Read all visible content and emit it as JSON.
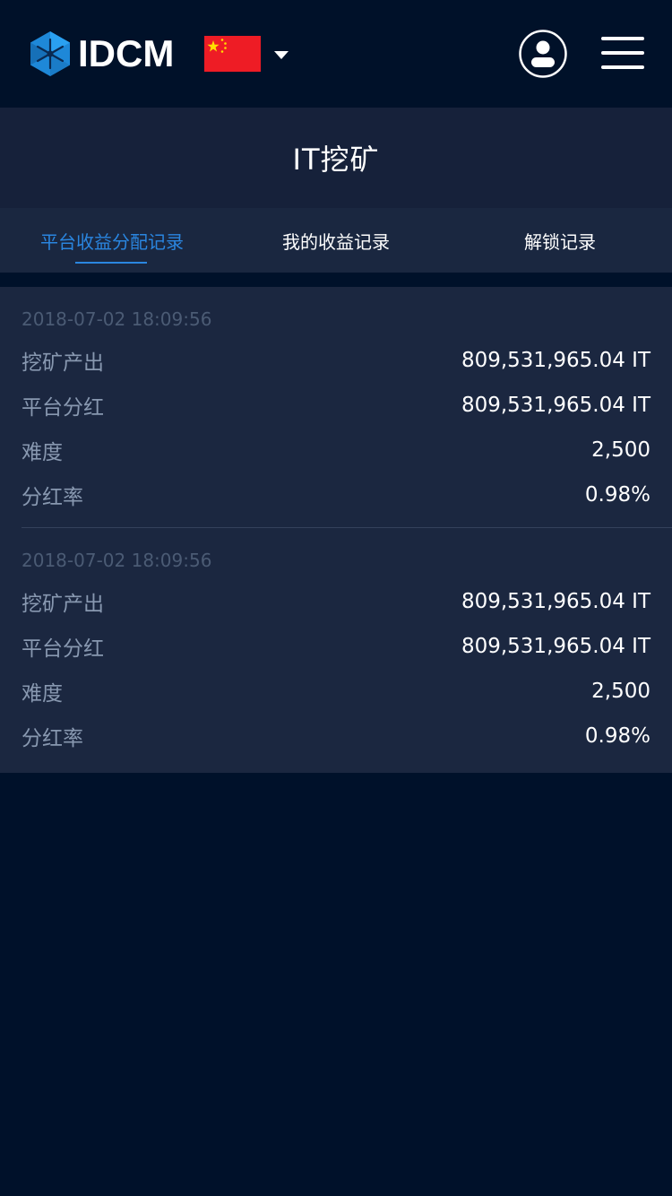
{
  "header": {
    "logo_text": "IDCM",
    "language_flag": "cn-flag",
    "colors": {
      "background": "#001129",
      "logo_blue": "#1e88d8",
      "flag_red": "#ee1c25",
      "flag_yellow": "#ffde00"
    }
  },
  "page": {
    "title": "IT挖矿"
  },
  "tabs": [
    {
      "label": "平台收益分配记录",
      "active": true
    },
    {
      "label": "我的收益记录",
      "active": false
    },
    {
      "label": "解锁记录",
      "active": false
    }
  ],
  "accent_color": "#2a86e0",
  "records": [
    {
      "time": "2018-07-02 18:09:56",
      "rows": [
        {
          "label": "挖矿产出",
          "value": "809,531,965.04 IT"
        },
        {
          "label": "平台分红",
          "value": "809,531,965.04 IT"
        },
        {
          "label": "难度",
          "value": "2,500"
        },
        {
          "label": "分红率",
          "value": "0.98%"
        }
      ]
    },
    {
      "time": "2018-07-02 18:09:56",
      "rows": [
        {
          "label": "挖矿产出",
          "value": "809,531,965.04 IT"
        },
        {
          "label": "平台分红",
          "value": "809,531,965.04 IT"
        },
        {
          "label": "难度",
          "value": "2,500"
        },
        {
          "label": "分红率",
          "value": "0.98%"
        }
      ]
    }
  ]
}
